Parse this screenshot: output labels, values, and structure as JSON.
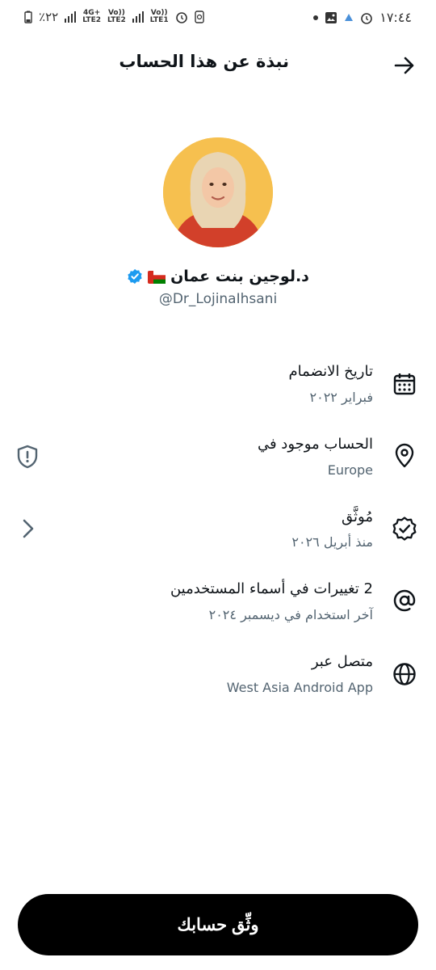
{
  "status_bar": {
    "battery": "٪٢٢",
    "network1": "4G+",
    "network1_sub": "LTE2",
    "volte1": "Vo))",
    "volte2": "Vo))",
    "network2_sub": "LTE1",
    "time": "١٧:٤٤"
  },
  "header": {
    "title": "نبذة عن هذا الحساب"
  },
  "profile": {
    "name": "د.لوجين بنت عمان",
    "handle": "@Dr_LojinaIhsani"
  },
  "rows": [
    {
      "title": "تاريخ الانضمام",
      "subtitle": "فبراير ٢٠٢٢",
      "icon": "calendar-icon"
    },
    {
      "title": "الحساب موجود في",
      "subtitle": "Europe",
      "icon": "location-pin-icon",
      "side_icon": "shield-alert-icon"
    },
    {
      "title": "مُوثَّق",
      "subtitle": "منذ أبريل ٢٠٢٦",
      "icon": "verified-badge-icon",
      "side_icon": "chevron-icon"
    },
    {
      "title": "2 تغييرات في أسماء المستخدمين",
      "subtitle": "آخر استخدام في ديسمبر ٢٠٢٤",
      "icon": "at-sign-icon"
    },
    {
      "title": "متصل عبر",
      "subtitle": "West Asia Android App",
      "icon": "globe-icon"
    }
  ],
  "cta": {
    "label": "وثِّق حسابك"
  },
  "colors": {
    "verified_blue": "#1d9bf0",
    "secondary_text": "#536471",
    "avatar_bg": "#f6c04f"
  }
}
